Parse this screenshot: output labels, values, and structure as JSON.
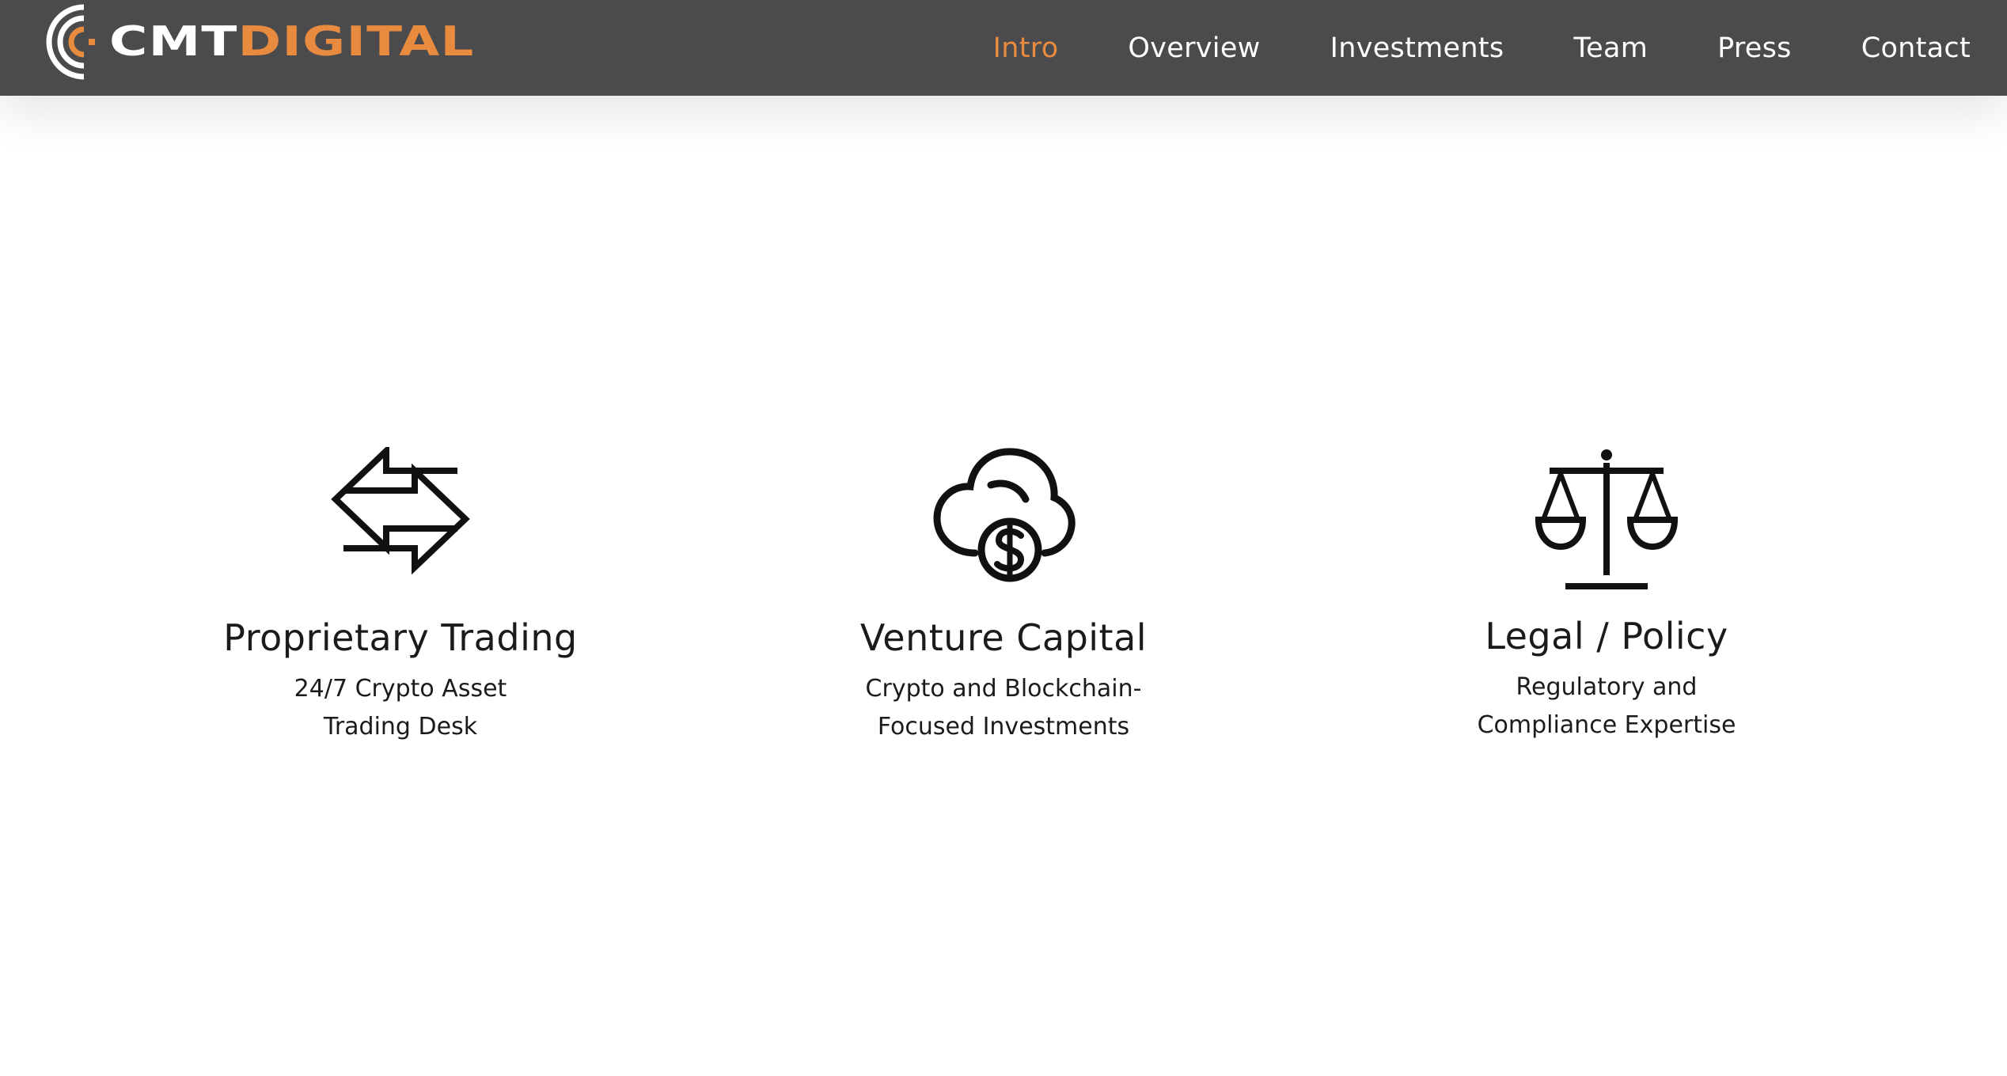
{
  "brand": {
    "name_primary": "CMT",
    "name_secondary": "DIGITAL",
    "accent_color": "#e98b3f",
    "nav_background": "#4b4b4d"
  },
  "nav": {
    "items": [
      {
        "label": "Intro",
        "active": true
      },
      {
        "label": "Overview",
        "active": false
      },
      {
        "label": "Investments",
        "active": false
      },
      {
        "label": "Team",
        "active": false
      },
      {
        "label": "Press",
        "active": false
      },
      {
        "label": "Contact",
        "active": false
      }
    ]
  },
  "services": [
    {
      "icon": "exchange-arrows-icon",
      "title": "Proprietary Trading",
      "desc_line1": "24/7 Crypto Asset",
      "desc_line2": "Trading Desk"
    },
    {
      "icon": "cloud-dollar-icon",
      "title": "Venture Capital",
      "desc_line1": "Crypto and Blockchain-",
      "desc_line2": "Focused Investments"
    },
    {
      "icon": "scales-icon",
      "title": "Legal / Policy",
      "desc_line1": "Regulatory and",
      "desc_line2": "Compliance Expertise"
    }
  ]
}
